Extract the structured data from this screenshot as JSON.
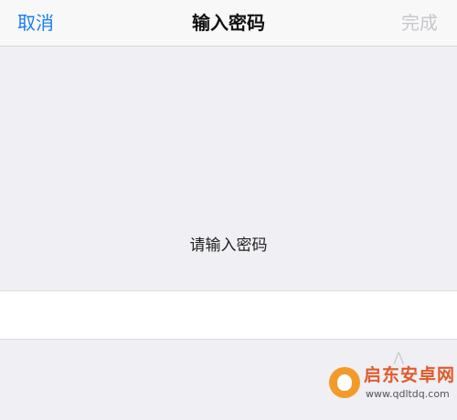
{
  "nav": {
    "cancel_label": "取消",
    "title": "输入密码",
    "done_label": "完成"
  },
  "main": {
    "prompt": "请输入密码",
    "password_value": ""
  },
  "watermark": {
    "name": "启东安卓网",
    "url": "www.qdltdq.com",
    "logo_icon": "smile-logo-icon",
    "brand_color": "#e05a2a"
  },
  "colors": {
    "accent": "#1a7ef2",
    "disabled": "#c7c7cc",
    "background": "#efeff4"
  }
}
